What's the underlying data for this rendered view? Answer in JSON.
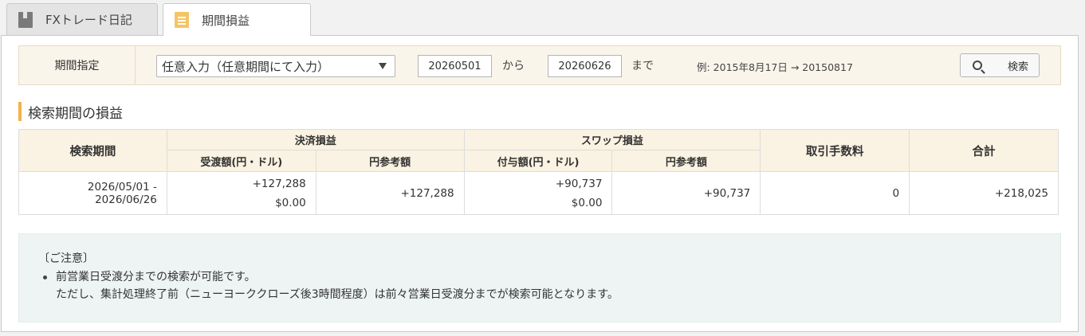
{
  "tabs": [
    {
      "label": "FXトレード日記",
      "icon": "book-icon",
      "active": false
    },
    {
      "label": "期間損益",
      "icon": "document-icon",
      "active": true
    }
  ],
  "search": {
    "label": "期間指定",
    "select_value": "任意入力（任意期間にて入力）",
    "from_value": "20260501",
    "from_suffix": "から",
    "to_value": "20260626",
    "to_suffix": "まで",
    "example": "例: 2015年8月17日 → 20150817",
    "button_label": "検索"
  },
  "section": {
    "title": "検索期間の損益"
  },
  "table": {
    "headers": {
      "period": "検索期間",
      "settlement": "決済損益",
      "settlement_amount": "受渡額(円・ドル)",
      "settlement_yen": "円参考額",
      "swap": "スワップ損益",
      "swap_amount": "付与額(円・ドル)",
      "swap_yen": "円参考額",
      "fee": "取引手数料",
      "total": "合計"
    },
    "row": {
      "period": "2026/05/01 - 2026/06/26",
      "settlement_yen_amount": "+127,288",
      "settlement_usd_amount": "$0.00",
      "settlement_yen_ref": "+127,288",
      "swap_yen_amount": "+90,737",
      "swap_usd_amount": "$0.00",
      "swap_yen_ref": "+90,737",
      "fee": "0",
      "total": "+218,025"
    }
  },
  "notice": {
    "title": "〔ご注意〕",
    "line1": "前営業日受渡分までの検索が可能です。",
    "line2": "ただし、集計処理終了前（ニューヨーククローズ後3時間程度）は前々営業日受渡分までが検索可能となります。"
  },
  "colors": {
    "accent": "#f5b14a",
    "header_bg": "#faf2e2",
    "notice_bg": "#eef4f3"
  }
}
